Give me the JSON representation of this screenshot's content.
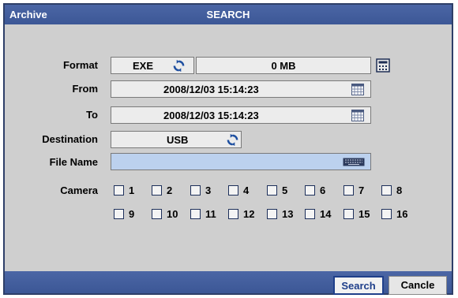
{
  "window": {
    "title_left": "Archive",
    "title_center": "SEARCH"
  },
  "form": {
    "format": {
      "label": "Format",
      "value": "EXE",
      "size": "0 MB"
    },
    "from": {
      "label": "From",
      "value": "2008/12/03  15:14:23"
    },
    "to": {
      "label": "To",
      "value": "2008/12/03  15:14:23"
    },
    "destination": {
      "label": "Destination",
      "value": "USB"
    },
    "file_name": {
      "label": "File Name",
      "value": ""
    },
    "camera": {
      "label": "Camera",
      "cameras": [
        "1",
        "2",
        "3",
        "4",
        "5",
        "6",
        "7",
        "8",
        "9",
        "10",
        "11",
        "12",
        "13",
        "14",
        "15",
        "16"
      ]
    }
  },
  "buttons": {
    "search": "Search",
    "cancel": "Cancle"
  },
  "icons": {
    "cycle": "cycle-icon",
    "calculator": "calculator-icon",
    "calendar": "calendar-icon",
    "keyboard": "keyboard-icon"
  },
  "colors": {
    "title_bar": "#3f5a99",
    "selected_field": "#bcd1ee",
    "panel": "#cfcfcf"
  }
}
